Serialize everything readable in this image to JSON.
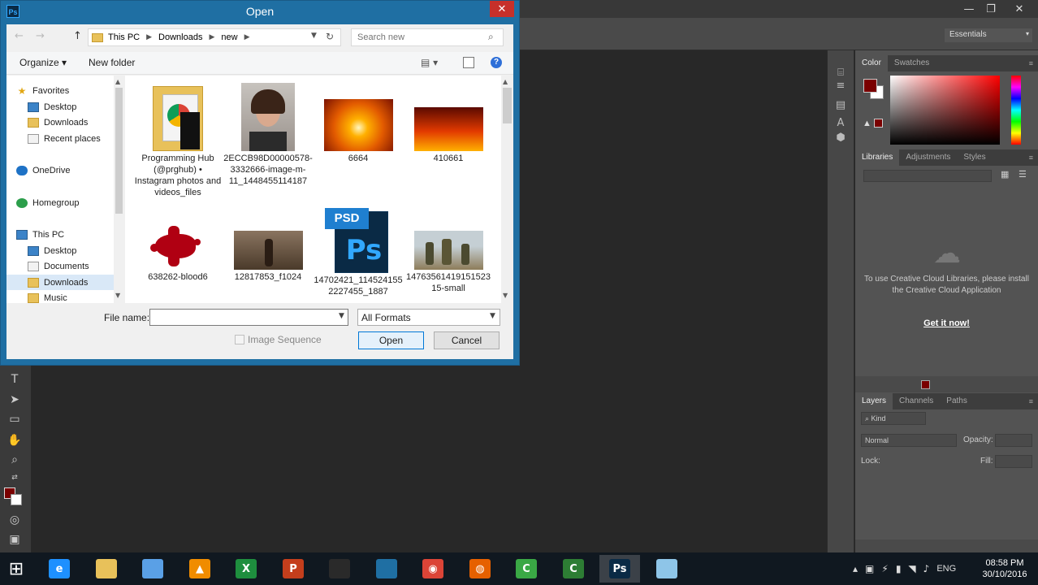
{
  "window": {
    "title": "Open",
    "app_icon_label": "Ps",
    "close_glyph": "✕"
  },
  "navigation": {
    "back_glyph": "←",
    "forward_glyph": "→",
    "up_glyph": "↑",
    "breadcrumbs": [
      "This PC",
      "Downloads",
      "new"
    ],
    "search_placeholder": "Search new"
  },
  "command_bar": {
    "organize_label": "Organize ▾",
    "new_folder_label": "New folder",
    "help_glyph": "?"
  },
  "nav_pane": {
    "items": [
      {
        "label": "Favorites",
        "icon": "star-icon"
      },
      {
        "label": "Desktop",
        "icon": "desktop-icon"
      },
      {
        "label": "Downloads",
        "icon": "downloads-icon"
      },
      {
        "label": "Recent places",
        "icon": "recent-places-icon"
      },
      {
        "label": "OneDrive",
        "icon": "onedrive-icon"
      },
      {
        "label": "Homegroup",
        "icon": "homegroup-icon"
      },
      {
        "label": "This PC",
        "icon": "this-pc-icon"
      },
      {
        "label": "Desktop",
        "icon": "desktop-icon"
      },
      {
        "label": "Documents",
        "icon": "documents-icon"
      },
      {
        "label": "Downloads",
        "icon": "downloads-icon"
      },
      {
        "label": "Music",
        "icon": "music-icon"
      }
    ],
    "selected": "Downloads"
  },
  "files": [
    {
      "name": "Programming Hub (@prghub) • Instagram photos and videos_files",
      "type": "folder"
    },
    {
      "name": "2ECCB98D00000578-3332666-image-m-11_1448455114187",
      "type": "image-portrait"
    },
    {
      "name": "6664",
      "type": "image-fire-burst"
    },
    {
      "name": "410661",
      "type": "image-fire"
    },
    {
      "name": "638262-blood6",
      "type": "image-blood-splatter"
    },
    {
      "name": "12817853_f1024",
      "type": "image-sepia-street"
    },
    {
      "name": "14702421_1145241552227455_1887",
      "type": "psd"
    },
    {
      "name": "1476356141915152315-small",
      "type": "image-soldiers"
    }
  ],
  "psd_badge": "PSD",
  "psd_logo": "Ps",
  "footer": {
    "file_name_label": "File name:",
    "file_name_value": "",
    "format_selected": "All Formats",
    "image_sequence_label": "Image Sequence",
    "image_sequence_checked": false,
    "open_label": "Open",
    "cancel_label": "Cancel"
  },
  "photoshop": {
    "workspace": "Essentials",
    "panel_tabs_color": [
      "Color",
      "Swatches"
    ],
    "panel_tabs_library": [
      "Libraries",
      "Adjustments",
      "Styles"
    ],
    "panel_tabs_layers": [
      "Layers",
      "Channels",
      "Paths"
    ],
    "cc_message": "To use Creative Cloud Libraries, please install the Creative Cloud Application",
    "cc_link": "Get it now!",
    "layers_kind": "Kind",
    "blend_mode": "Normal",
    "opacity_label": "Opacity:",
    "lock_label": "Lock:",
    "fill_label": "Fill:",
    "foreground_color": "#7a0000"
  },
  "taskbar": {
    "apps": [
      {
        "name": "internet-explorer",
        "glyph": "e",
        "color": "#1e90ff"
      },
      {
        "name": "file-explorer",
        "glyph": "",
        "color": "#e8c15a"
      },
      {
        "name": "3d-app",
        "glyph": "",
        "color": "#5aa0e6"
      },
      {
        "name": "vlc",
        "glyph": "▲",
        "color": "#f08c00"
      },
      {
        "name": "excel",
        "glyph": "X",
        "color": "#1e8e3e"
      },
      {
        "name": "powerpoint",
        "glyph": "P",
        "color": "#c43e1c"
      },
      {
        "name": "media-app",
        "glyph": "",
        "color": "#2a2a2a"
      },
      {
        "name": "blue-app",
        "glyph": "",
        "color": "#1f6fa3"
      },
      {
        "name": "chrome",
        "glyph": "◉",
        "color": "#db4437"
      },
      {
        "name": "firefox",
        "glyph": "◍",
        "color": "#e66000"
      },
      {
        "name": "camtasia",
        "glyph": "C",
        "color": "#3aa845"
      },
      {
        "name": "camtasia-recorder",
        "glyph": "C",
        "color": "#2d7d34"
      },
      {
        "name": "photoshop",
        "glyph": "Ps",
        "color": "#0a2a45"
      },
      {
        "name": "notepad",
        "glyph": "",
        "color": "#8ec5e8"
      }
    ],
    "language": "ENG",
    "time": "08:58 PM",
    "date": "30/10/2016"
  }
}
